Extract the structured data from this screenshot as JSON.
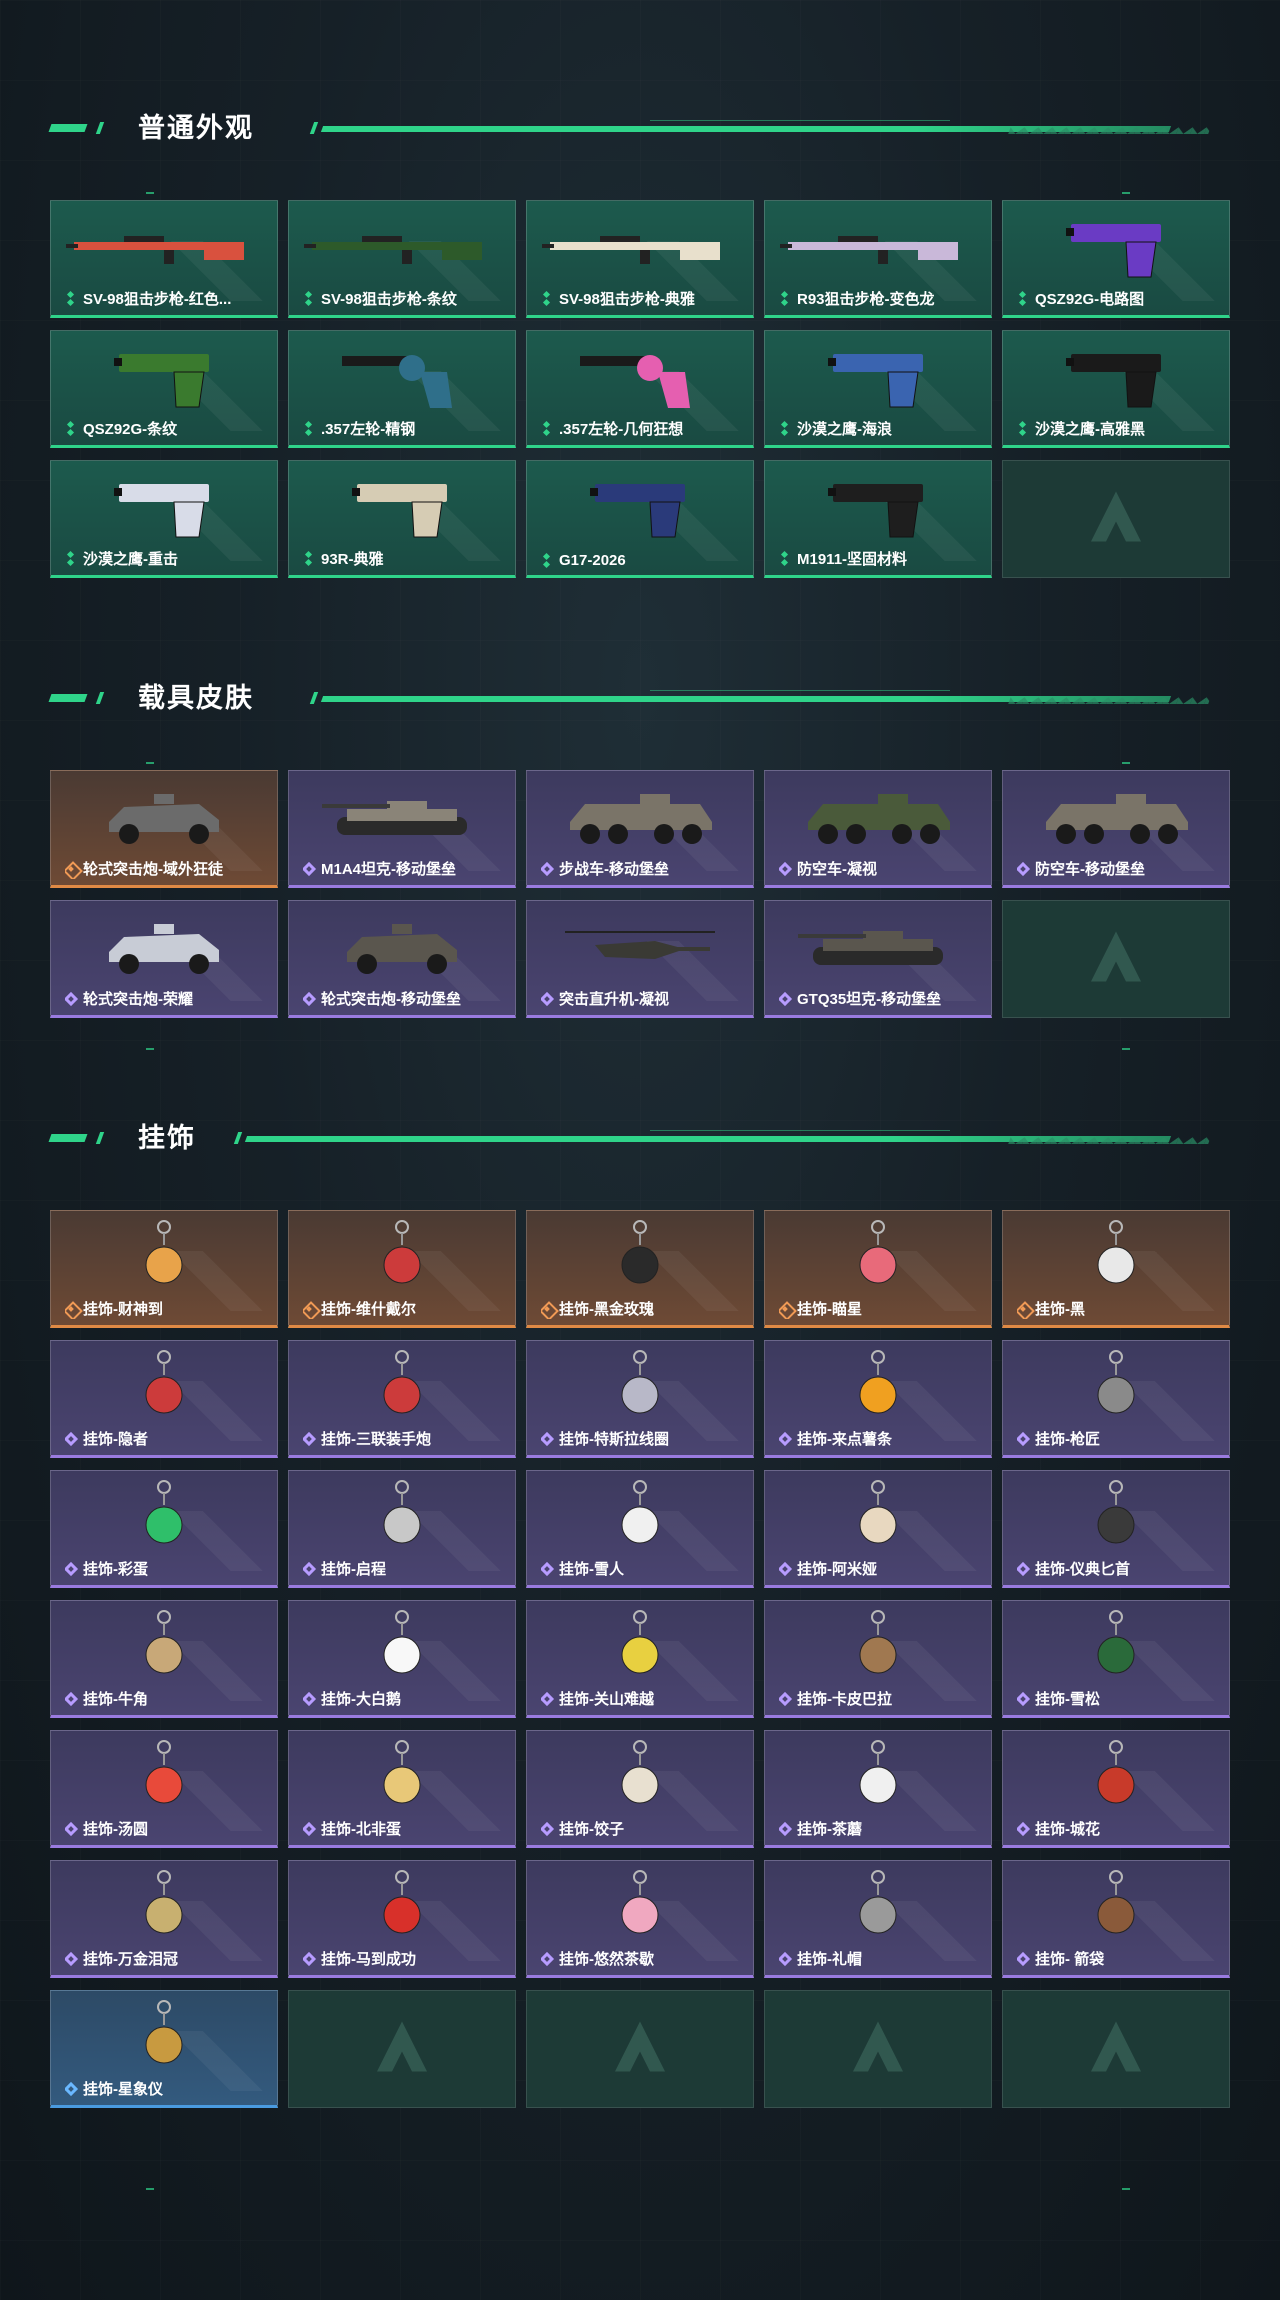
{
  "sections": {
    "normal": {
      "title": "普通外观",
      "items": [
        {
          "label": "SV-98狙击步枪-红色...",
          "rarity": "green",
          "icon": "rifle-icon",
          "color": "#d9513e"
        },
        {
          "label": "SV-98狙击步枪-条纹",
          "rarity": "green",
          "icon": "rifle-icon",
          "color": "#2d5a2a"
        },
        {
          "label": "SV-98狙击步枪-典雅",
          "rarity": "green",
          "icon": "rifle-icon",
          "color": "#e8e0cc"
        },
        {
          "label": "R93狙击步枪-变色龙",
          "rarity": "green",
          "icon": "rifle-icon",
          "color": "#c9b8d9"
        },
        {
          "label": "QSZ92G-电路图",
          "rarity": "green",
          "icon": "pistol-icon",
          "color": "#6a3bc4"
        },
        {
          "label": "QSZ92G-条纹",
          "rarity": "green",
          "icon": "pistol-icon",
          "color": "#3a7a2e"
        },
        {
          "label": ".357左轮-精钢",
          "rarity": "green",
          "icon": "revolver-icon",
          "color": "#2f6f8a"
        },
        {
          "label": ".357左轮-几何狂想",
          "rarity": "green",
          "icon": "revolver-icon",
          "color": "#e55fb0"
        },
        {
          "label": "沙漠之鹰-海浪",
          "rarity": "green",
          "icon": "pistol-icon",
          "color": "#3a64b0"
        },
        {
          "label": "沙漠之鹰-高雅黑",
          "rarity": "green",
          "icon": "pistol-icon",
          "color": "#1a1a1a"
        },
        {
          "label": "沙漠之鹰-重击",
          "rarity": "green",
          "icon": "pistol-icon",
          "color": "#d8dce8"
        },
        {
          "label": "93R-典雅",
          "rarity": "green",
          "icon": "pistol-icon",
          "color": "#d6ccb4"
        },
        {
          "label": "G17-2026",
          "rarity": "green",
          "icon": "pistol-icon",
          "color": "#2a3a7a"
        },
        {
          "label": "M1911-坚固材料",
          "rarity": "green",
          "icon": "pistol-icon",
          "color": "#1e1e1e"
        },
        {
          "label": "",
          "rarity": "empty",
          "icon": "logo-icon",
          "color": ""
        }
      ]
    },
    "vehicle": {
      "title": "载具皮肤",
      "items": [
        {
          "label": "轮式突击炮-域外狂徒",
          "rarity": "orange",
          "icon": "car-icon",
          "color": "#6b6b6b"
        },
        {
          "label": "M1A4坦克-移动堡垒",
          "rarity": "purple",
          "icon": "tank-icon",
          "color": "#8a8478"
        },
        {
          "label": "步战车-移动堡垒",
          "rarity": "purple",
          "icon": "apc-icon",
          "color": "#7a7468"
        },
        {
          "label": "防空车-凝视",
          "rarity": "purple",
          "icon": "apc-icon",
          "color": "#4a5a3a"
        },
        {
          "label": "防空车-移动堡垒",
          "rarity": "purple",
          "icon": "apc-icon",
          "color": "#7a7468"
        },
        {
          "label": "轮式突击炮-荣耀",
          "rarity": "purple",
          "icon": "car-icon",
          "color": "#c8ccd6"
        },
        {
          "label": "轮式突击炮-移动堡垒",
          "rarity": "purple",
          "icon": "car-icon",
          "color": "#5a564e"
        },
        {
          "label": "突击直升机-凝视",
          "rarity": "purple",
          "icon": "helicopter-icon",
          "color": "#3a3a34"
        },
        {
          "label": "GTQ35坦克-移动堡垒",
          "rarity": "purple",
          "icon": "tank-icon",
          "color": "#5a564e"
        },
        {
          "label": "",
          "rarity": "empty",
          "icon": "logo-icon",
          "color": ""
        }
      ]
    },
    "charm": {
      "title": "挂饰",
      "items": [
        {
          "label": "挂饰-财神到",
          "rarity": "orange",
          "icon": "charm-icon",
          "color": "#e8a34a"
        },
        {
          "label": "挂饰-维什戴尔",
          "rarity": "orange",
          "icon": "charm-icon",
          "color": "#cc3b3b"
        },
        {
          "label": "挂饰-黑金玫瑰",
          "rarity": "orange",
          "icon": "charm-icon",
          "color": "#2a2a2a"
        },
        {
          "label": "挂饰-瞄星",
          "rarity": "orange",
          "icon": "charm-icon",
          "color": "#e86a7a"
        },
        {
          "label": "挂饰-黑",
          "rarity": "orange",
          "icon": "charm-icon",
          "color": "#e8e8e8"
        },
        {
          "label": "挂饰-隐者",
          "rarity": "purple",
          "icon": "charm-icon",
          "color": "#cc3b3b"
        },
        {
          "label": "挂饰-三联装手炮",
          "rarity": "purple",
          "icon": "charm-icon",
          "color": "#cc3b3b"
        },
        {
          "label": "挂饰-特斯拉线圈",
          "rarity": "purple",
          "icon": "charm-icon",
          "color": "#b8b8c8"
        },
        {
          "label": "挂饰-来点薯条",
          "rarity": "purple",
          "icon": "charm-icon",
          "color": "#f0a020"
        },
        {
          "label": "挂饰-枪匠",
          "rarity": "purple",
          "icon": "charm-icon",
          "color": "#8a8a8a"
        },
        {
          "label": "挂饰-彩蛋",
          "rarity": "purple",
          "icon": "charm-icon",
          "color": "#2fbf6a"
        },
        {
          "label": "挂饰-启程",
          "rarity": "purple",
          "icon": "charm-icon",
          "color": "#c8c8c8"
        },
        {
          "label": "挂饰-雪人",
          "rarity": "purple",
          "icon": "charm-icon",
          "color": "#f0f0f0"
        },
        {
          "label": "挂饰-阿米娅",
          "rarity": "purple",
          "icon": "charm-icon",
          "color": "#e8d8c0"
        },
        {
          "label": "挂饰-仪典匕首",
          "rarity": "purple",
          "icon": "charm-icon",
          "color": "#3a3a3a"
        },
        {
          "label": "挂饰-牛角",
          "rarity": "purple",
          "icon": "charm-icon",
          "color": "#c8a878"
        },
        {
          "label": "挂饰-大白鹅",
          "rarity": "purple",
          "icon": "charm-icon",
          "color": "#f8f8f8"
        },
        {
          "label": "挂饰-关山难越",
          "rarity": "purple",
          "icon": "charm-icon",
          "color": "#e8d040"
        },
        {
          "label": "挂饰-卡皮巴拉",
          "rarity": "purple",
          "icon": "charm-icon",
          "color": "#a07850"
        },
        {
          "label": "挂饰-雪松",
          "rarity": "purple",
          "icon": "charm-icon",
          "color": "#2a6a3a"
        },
        {
          "label": "挂饰-汤圆",
          "rarity": "purple",
          "icon": "charm-icon",
          "color": "#e84a3a"
        },
        {
          "label": "挂饰-北非蛋",
          "rarity": "purple",
          "icon": "charm-icon",
          "color": "#e8c878"
        },
        {
          "label": "挂饰-饺子",
          "rarity": "purple",
          "icon": "charm-icon",
          "color": "#e8e0d0"
        },
        {
          "label": "挂饰-茶蘑",
          "rarity": "purple",
          "icon": "charm-icon",
          "color": "#f0f0f0"
        },
        {
          "label": "挂饰-城花",
          "rarity": "purple",
          "icon": "charm-icon",
          "color": "#c83a2a"
        },
        {
          "label": "挂饰-万金泪冠",
          "rarity": "purple",
          "icon": "charm-icon",
          "color": "#c8b070"
        },
        {
          "label": "挂饰-马到成功",
          "rarity": "purple",
          "icon": "charm-icon",
          "color": "#d8302a"
        },
        {
          "label": "挂饰-悠然茶歇",
          "rarity": "purple",
          "icon": "charm-icon",
          "color": "#f0a8c0"
        },
        {
          "label": "挂饰-礼帽",
          "rarity": "purple",
          "icon": "charm-icon",
          "color": "#9a9a9a"
        },
        {
          "label": "挂饰- 箭袋",
          "rarity": "purple",
          "icon": "charm-icon",
          "color": "#8a5a3a"
        },
        {
          "label": "挂饰-星象仪",
          "rarity": "blue",
          "icon": "charm-icon",
          "color": "#c89a40"
        },
        {
          "label": "",
          "rarity": "empty",
          "icon": "logo-icon",
          "color": ""
        },
        {
          "label": "",
          "rarity": "empty",
          "icon": "logo-icon",
          "color": ""
        },
        {
          "label": "",
          "rarity": "empty",
          "icon": "logo-icon",
          "color": ""
        },
        {
          "label": "",
          "rarity": "empty",
          "icon": "logo-icon",
          "color": ""
        }
      ]
    }
  },
  "colors": {
    "accent": "#2fd48a",
    "purple": "#9a7be0",
    "orange": "#e08a45",
    "blue": "#4a9be0"
  }
}
